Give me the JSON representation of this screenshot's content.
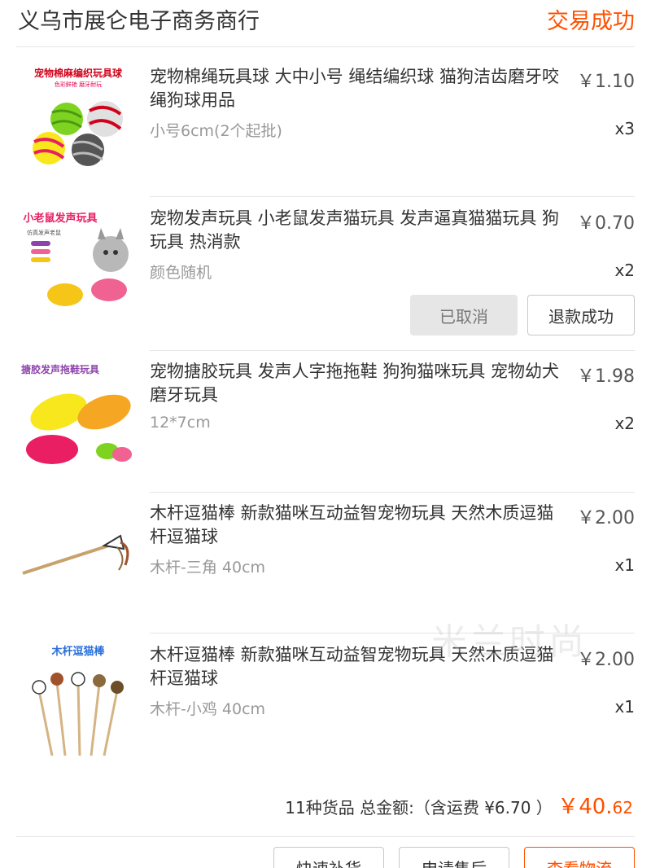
{
  "header": {
    "shop_name": "义乌市展仑电子商务商行",
    "status": "交易成功"
  },
  "items": [
    {
      "title": "宠物棉绳玩具球 大中小号 绳结编织球 猫狗洁齿磨牙咬绳狗球用品",
      "sku": "小号6cm(2个起批)",
      "price": "￥1.10",
      "qty": "x3",
      "thumb_caption": "宠物棉麻编织玩具球",
      "thumb_subcaption": "色彩鲜艳 磨牙耐玩"
    },
    {
      "title": "宠物发声玩具 小老鼠发声猫玩具 发声逼真猫猫玩具 狗玩具 热消款",
      "sku": "颜色随机",
      "price": "￥0.70",
      "qty": "x2",
      "thumb_caption": "小老鼠发声玩具",
      "thumb_subcaption": "仿真发声老鼠",
      "buttons": {
        "cancelled": "已取消",
        "refund": "退款成功"
      }
    },
    {
      "title": "宠物搪胶玩具 发声人字拖拖鞋 狗狗猫咪玩具 宠物幼犬磨牙玩具",
      "sku": "12*7cm",
      "price": "￥1.98",
      "qty": "x2",
      "thumb_caption": "搪胶发声拖鞋玩具"
    },
    {
      "title": "木杆逗猫棒 新款猫咪互动益智宠物玩具 天然木质逗猫杆逗猫球",
      "sku": "木杆-三角 40cm",
      "price": "￥2.00",
      "qty": "x1"
    },
    {
      "title": "木杆逗猫棒 新款猫咪互动益智宠物玩具 天然木质逗猫杆逗猫球",
      "sku": "木杆-小鸡 40cm",
      "price": "￥2.00",
      "qty": "x1",
      "thumb_caption": "木杆逗猫棒"
    }
  ],
  "summary": {
    "label": "11种货品 总金额:（含运费 ¥6.70 ）",
    "currency": "￥",
    "amount_main": "40.",
    "amount_cents": "62"
  },
  "actions": {
    "btn1": "快速补货",
    "btn2": "申请售后",
    "btn3": "查看物流"
  },
  "watermark": "米兰时尚",
  "colors": {
    "accent": "#ff5000",
    "muted": "#999999",
    "divider": "#e5e5e5"
  }
}
